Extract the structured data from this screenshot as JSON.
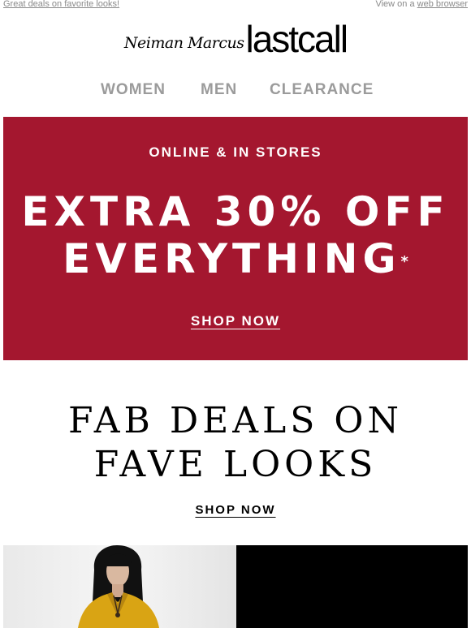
{
  "preheader": {
    "left_link": "Great deals on favorite looks!",
    "right_prefix": "View on a ",
    "right_link": "web browser"
  },
  "logo": {
    "script_text": "Neiman Marcus",
    "word_text": "lastcall"
  },
  "nav": {
    "items": [
      {
        "label": "WOMEN"
      },
      {
        "label": "MEN"
      },
      {
        "label": "CLEARANCE"
      }
    ]
  },
  "banner": {
    "background_color": "#a4172f",
    "eyebrow": "ONLINE & IN STORES",
    "headline_line1": "EXTRA 30% OFF",
    "headline_line2": "EVERYTHING",
    "asterisk": "*",
    "cta": "SHOP NOW"
  },
  "promo": {
    "line1": "FAB DEALS ON",
    "line2": "FAVE LOOKS",
    "cta": "SHOP NOW"
  },
  "colors": {
    "accent": "#a4172f",
    "nav_gray": "#9b9b9b",
    "preheader_gray": "#8a8a8a"
  }
}
